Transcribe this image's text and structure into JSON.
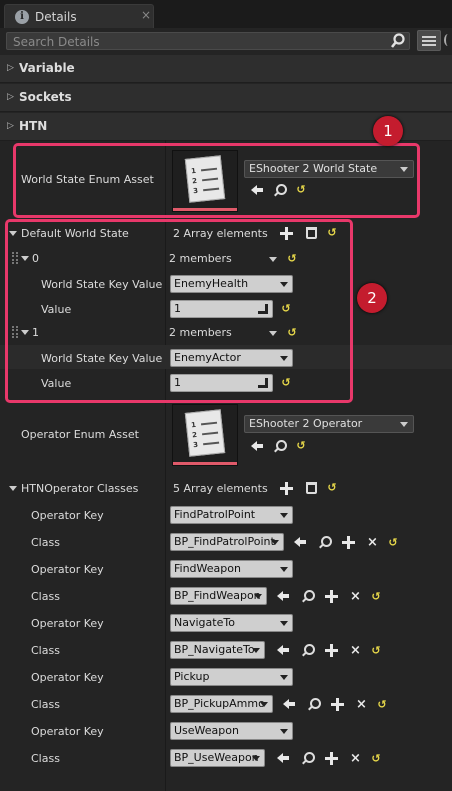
{
  "tab": {
    "title": "Details"
  },
  "search": {
    "placeholder": "Search Details"
  },
  "categories": {
    "variable": "Variable",
    "sockets": "Sockets",
    "htn": "HTN"
  },
  "world_state_enum": {
    "label": "World State Enum Asset",
    "asset": "EShooter 2 World State"
  },
  "default_world_state": {
    "label": "Default World State",
    "count": "2 Array elements",
    "elements": [
      {
        "index": "0",
        "members": "2 members",
        "key_label": "World State Key Value",
        "key": "EnemyHealth",
        "value_label": "Value",
        "value": "1"
      },
      {
        "index": "1",
        "members": "2 members",
        "key_label": "World State Key Value",
        "key": "EnemyActor",
        "value_label": "Value",
        "value": "1"
      }
    ]
  },
  "operator_enum": {
    "label": "Operator Enum Asset",
    "asset": "EShooter 2 Operator"
  },
  "htn_operator_classes": {
    "label": "HTNOperator Classes",
    "count": "5 Array elements",
    "rows": [
      {
        "key_label": "Operator Key",
        "key": "FindPatrolPoint",
        "class_label": "Class",
        "class": "BP_FindPatrolPoint"
      },
      {
        "key_label": "Operator Key",
        "key": "FindWeapon",
        "class_label": "Class",
        "class": "BP_FindWeapon"
      },
      {
        "key_label": "Operator Key",
        "key": "NavigateTo",
        "class_label": "Class",
        "class": "BP_NavigateTo"
      },
      {
        "key_label": "Operator Key",
        "key": "Pickup",
        "class_label": "Class",
        "class": "BP_PickupAmmo"
      },
      {
        "key_label": "Operator Key",
        "key": "UseWeapon",
        "class_label": "Class",
        "class": "BP_UseWeapon"
      }
    ]
  },
  "annotations": [
    "1",
    "2"
  ],
  "icons": {
    "reset": "↺",
    "close": "×"
  },
  "colors": {
    "highlight": "#e8386a",
    "badge": "#c41c2e",
    "reset": "#e8d94a"
  }
}
